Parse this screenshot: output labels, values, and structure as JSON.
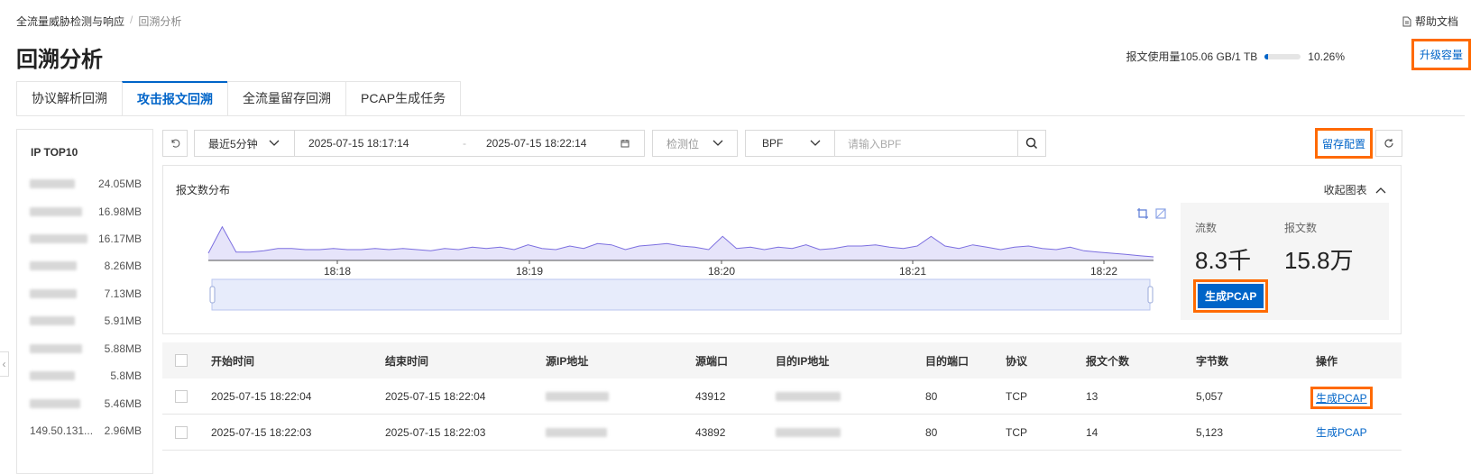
{
  "breadcrumb": {
    "root": "全流量威胁检测与响应",
    "current": "回溯分析"
  },
  "help": {
    "label": "帮助文档"
  },
  "page": {
    "title": "回溯分析"
  },
  "usage": {
    "text": "报文使用量105.06 GB/1 TB",
    "percent_label": "10.26%",
    "percent": 0.1026,
    "upgrade_label": "升级容量"
  },
  "tabs": [
    {
      "label": "协议解析回溯",
      "active": false
    },
    {
      "label": "攻击报文回溯",
      "active": true
    },
    {
      "label": "全流量留存回溯",
      "active": false
    },
    {
      "label": "PCAP生成任务",
      "active": false
    }
  ],
  "sidebar": {
    "title": "IP TOP10",
    "items": [
      {
        "ip": "",
        "size": "24.05MB"
      },
      {
        "ip": "",
        "size": "16.98MB"
      },
      {
        "ip": "",
        "size": "16.17MB"
      },
      {
        "ip": "",
        "size": "8.26MB"
      },
      {
        "ip": "",
        "size": "7.13MB"
      },
      {
        "ip": "",
        "size": "5.91MB"
      },
      {
        "ip": "",
        "size": "5.88MB"
      },
      {
        "ip": "",
        "size": "5.8MB"
      },
      {
        "ip": "",
        "size": "5.46MB"
      },
      {
        "ip": "149.50.131...",
        "size": "2.96MB"
      }
    ]
  },
  "filters": {
    "time_range": "最近5分钟",
    "start_time": "2025-07-15 18:17:14",
    "end_time": "2025-07-15 18:22:14",
    "position_placeholder": "检测位",
    "bpf_type": "BPF",
    "bpf_placeholder": "请输入BPF",
    "retention_config": "留存配置"
  },
  "chart": {
    "title": "报文数分布",
    "collapse_label": "收起图表",
    "flow_label": "流数",
    "flow_value": "8.3千",
    "packet_label": "报文数",
    "packet_value": "15.8万",
    "generate_pcap": "生成PCAP"
  },
  "chart_data": {
    "type": "area",
    "x_ticks": [
      "18:18",
      "18:19",
      "18:20",
      "18:21",
      "18:22"
    ],
    "values": [
      6,
      28,
      7,
      7,
      8,
      10,
      10,
      9,
      9,
      10,
      9,
      9,
      10,
      9,
      10,
      9,
      8,
      10,
      9,
      11,
      10,
      11,
      9,
      13,
      10,
      9,
      12,
      10,
      14,
      13,
      9,
      12,
      13,
      14,
      12,
      11,
      9,
      20,
      10,
      11,
      9,
      11,
      10,
      13,
      9,
      10,
      12,
      12,
      13,
      11,
      10,
      12,
      20,
      12,
      10,
      13,
      11,
      9,
      11,
      12,
      10,
      9,
      11,
      8,
      7,
      6,
      5,
      4,
      3
    ]
  },
  "table": {
    "headers": [
      "开始时间",
      "结束时间",
      "源IP地址",
      "源端口",
      "目的IP地址",
      "目的端口",
      "协议",
      "报文个数",
      "字节数",
      "操作"
    ],
    "rows": [
      {
        "start": "2025-07-15 18:22:04",
        "end": "2025-07-15 18:22:04",
        "sport": "43912",
        "dport": "80",
        "proto": "TCP",
        "count": "13",
        "bytes": "5,057",
        "action": "生成PCAP"
      },
      {
        "start": "2025-07-15 18:22:03",
        "end": "2025-07-15 18:22:03",
        "sport": "43892",
        "dport": "80",
        "proto": "TCP",
        "count": "14",
        "bytes": "5,123",
        "action": "生成PCAP"
      }
    ]
  }
}
